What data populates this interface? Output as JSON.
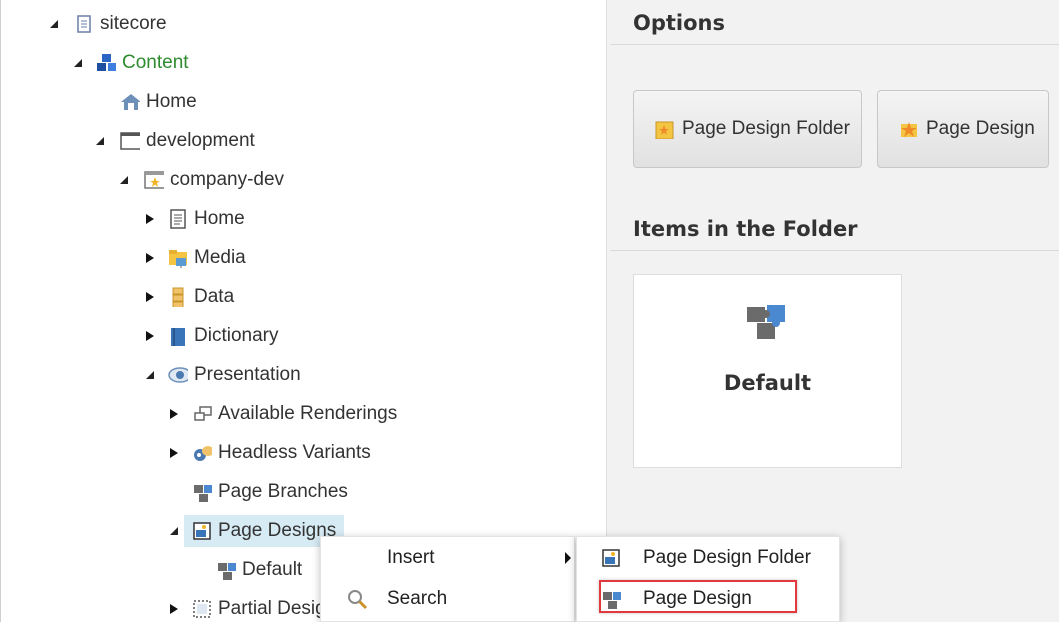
{
  "tree": {
    "sitecore": "sitecore",
    "content": "Content",
    "home_root": "Home",
    "development": "development",
    "company_dev": "company-dev",
    "home": "Home",
    "media": "Media",
    "data": "Data",
    "dictionary": "Dictionary",
    "presentation": "Presentation",
    "available_renderings": "Available Renderings",
    "headless_variants": "Headless Variants",
    "page_branches": "Page Branches",
    "page_designs": "Page Designs",
    "default": "Default",
    "partial_designs": "Partial Designs"
  },
  "options": {
    "title": "Options",
    "page_design_folder_btn": "Page Design Folder",
    "page_design_btn": "Page Design"
  },
  "items_in_folder": {
    "title": "Items in the Folder",
    "items": [
      "Default"
    ]
  },
  "context_menu": {
    "insert": "Insert",
    "search": "Search"
  },
  "submenu": {
    "page_design_folder": "Page Design Folder",
    "page_design": "Page Design"
  },
  "colors": {
    "content_green": "#2e8b2e",
    "selected_bg": "#d7ebf5",
    "highlight_red": "#e0393e"
  }
}
